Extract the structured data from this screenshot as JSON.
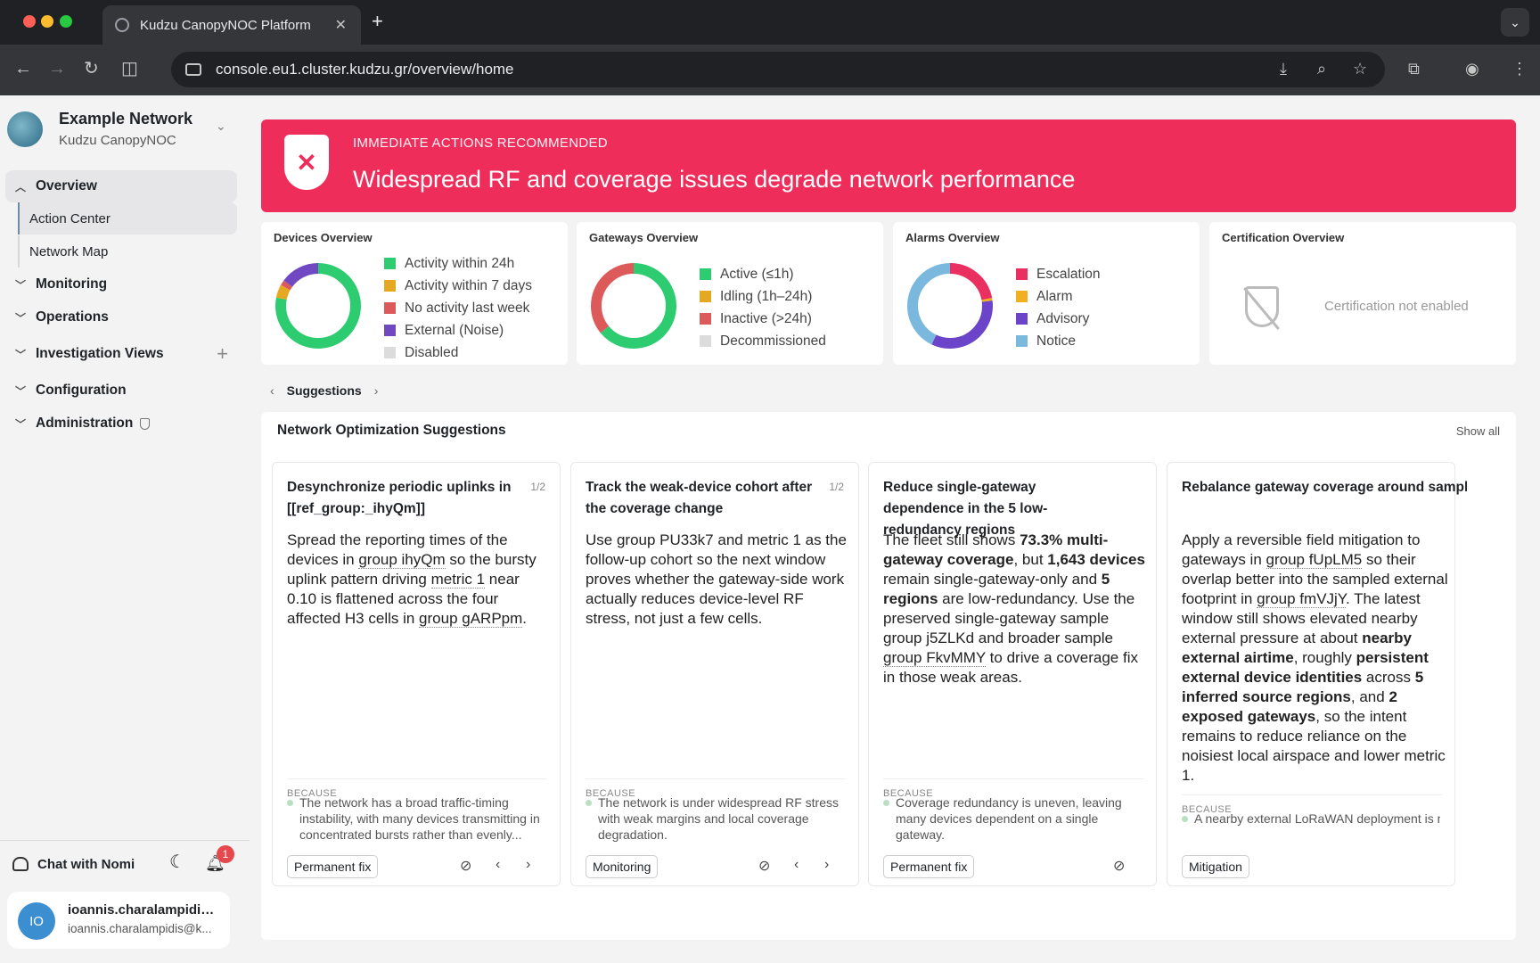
{
  "browser": {
    "tab_title": "Kudzu CanopyNOC Platform",
    "url": "console.eu1.cluster.kudzu.gr/overview/home"
  },
  "sidebar": {
    "org_name": "Example Network",
    "org_sub": "Kudzu CanopyNOC",
    "items": [
      {
        "label": "Overview"
      },
      {
        "label": "Action Center"
      },
      {
        "label": "Network Map"
      },
      {
        "label": "Monitoring"
      },
      {
        "label": "Operations"
      },
      {
        "label": "Investigation Views"
      },
      {
        "label": "Configuration"
      },
      {
        "label": "Administration"
      }
    ],
    "chat_label": "Chat with Nomi",
    "notification_count": "1",
    "user": {
      "initials": "IO",
      "name": "ioannis.charalampidis...",
      "email": "ioannis.charalampidis@k..."
    }
  },
  "banner": {
    "kicker": "IMMEDIATE ACTIONS RECOMMENDED",
    "title": "Widespread RF and coverage issues degrade network performance",
    "color": "#ee2d5b"
  },
  "overviews": {
    "devices": {
      "title": "Devices Overview",
      "legend": [
        "Activity within 24h",
        "Activity within 7 days",
        "No activity last week",
        "External (Noise)",
        "Disabled"
      ],
      "colors": [
        "#2ecc71",
        "#e7a821",
        "#dc5a5a",
        "#7048c1",
        "#dcdcdc"
      ],
      "shares": [
        0.78,
        0.05,
        0.02,
        0.15,
        0
      ]
    },
    "gateways": {
      "title": "Gateways Overview",
      "legend": [
        "Active (≤1h)",
        "Idling (1h–24h)",
        "Inactive (>24h)",
        "Decommissioned"
      ],
      "colors": [
        "#2ecc71",
        "#e7a821",
        "#dc5a5a",
        "#dcdcdc"
      ],
      "shares": [
        0.64,
        0,
        0.36,
        0
      ]
    },
    "alarms": {
      "title": "Alarms Overview",
      "legend": [
        "Escalation",
        "Alarm",
        "Advisory",
        "Notice"
      ],
      "colors": [
        "#ea3060",
        "#f0b020",
        "#6b44c9",
        "#7bb8dd"
      ],
      "shares": [
        0.22,
        0.01,
        0.34,
        0.43
      ]
    },
    "certification": {
      "title": "Certification Overview",
      "text": "Certification not enabled"
    }
  },
  "suggestions_nav": "Suggestions",
  "panel": {
    "title": "Network Optimization Suggestions",
    "show_all": "Show all",
    "because_label": "BECAUSE",
    "cards": [
      {
        "title": "Desynchronize periodic uplinks in [[ref_group:_ihyQm]]",
        "page": "1/2",
        "body_html": "Spread the reporting times of the devices in <span class='u'>group ihyQm</span> so the bursty uplink pattern driving <span class='u'>metric 1</span> near 0.10 is flattened across the four affected H3 cells in <span class='u'>group gARPpm</span>.",
        "because": "The network has a broad traffic-timing instability, with many devices transmitting in concentrated bursts rather than evenly...",
        "chip": "Permanent fix"
      },
      {
        "title": "Track the weak-device cohort after the coverage change",
        "page": "1/2",
        "body_html": "Use group PU33k7 and metric 1 as the follow-up cohort so the next window proves whether the gateway-side work actually reduces device-level RF stress, not just a few cells.",
        "because": "The network is under widespread RF stress with weak margins and local coverage degradation.",
        "chip": "Monitoring"
      },
      {
        "title": "Reduce single-gateway dependence in the 5 low-redundancy regions",
        "page": "",
        "body_html": "The fleet still shows <b>73.3% multi-gateway coverage</b>, but <b>1,643 devices</b> remain single-gateway-only and <b>5 regions</b> are low-redundancy. Use the preserved single-gateway sample group j5ZLKd and broader sample <span class='u'>group FkvMMY</span> to drive a coverage fix in those weak areas.",
        "because": "Coverage redundancy is uneven, leaving many devices dependent on a single gateway.",
        "chip": "Permanent fix"
      },
      {
        "title": "Rebalance gateway coverage around sampled external contention footprint",
        "page": "",
        "body_html": "Apply a reversible field mitigation to gateways in <span class='u'>group fUpLM5</span> so their overlap better into the sampled external footprint in <span class='u'>group fmVJjY</span>. The latest window still shows elevated nearby external pressure at about <b>nearby external airtime</b>, roughly <b>persistent external device identities</b> across <b>5 inferred source regions</b>, and <b>2 exposed gateways</b>, so the intent remains to reduce reliance on the noisiest local airspace and lower metric 1.",
        "because": "A nearby external LoRaWAN deployment is materially contributing to RF contention.",
        "chip": "Mitigation"
      }
    ]
  }
}
